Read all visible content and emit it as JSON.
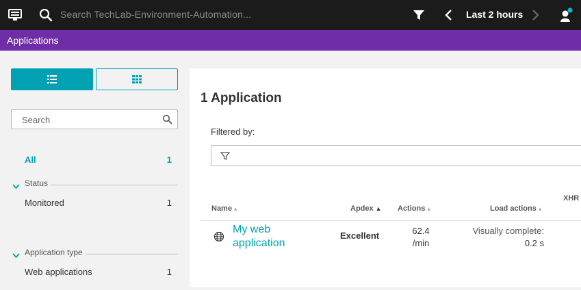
{
  "topbar": {
    "search_placeholder": "Search TechLab-Environment-Automation...",
    "timeframe": "Last 2 hours",
    "icons": [
      "menu-icon",
      "search-icon",
      "filter-icon",
      "chevron-left-icon",
      "chevron-right-icon",
      "user-icon"
    ]
  },
  "header": {
    "title": "Applications"
  },
  "sidebar": {
    "view_modes": [
      "list-view-icon",
      "tile-view-icon"
    ],
    "search_placeholder": "Search",
    "all": {
      "label": "All",
      "count": "1"
    },
    "groups": [
      {
        "title": "Status",
        "items": [
          {
            "label": "Monitored",
            "count": "1"
          }
        ]
      },
      {
        "title": "Application type",
        "items": [
          {
            "label": "Web applications",
            "count": "1"
          }
        ]
      }
    ]
  },
  "main": {
    "app_count": "1 Application",
    "filtered_by": "Filtered by:",
    "columns": {
      "name": "Name",
      "apdex": "Apdex",
      "actions": "Actions",
      "load_actions": "Load actions",
      "xhr": "XHR"
    },
    "rows": [
      {
        "name": "My web application",
        "apdex": "Excellent",
        "actions_value": "62.4",
        "actions_unit": "/min",
        "load_label": "Visually complete:",
        "load_value": "0.2 s"
      }
    ]
  },
  "colors": {
    "topbar": "#1b1b1b",
    "header": "#6f2da8",
    "accent": "#00a1b2",
    "background": "#f2f2f2"
  }
}
